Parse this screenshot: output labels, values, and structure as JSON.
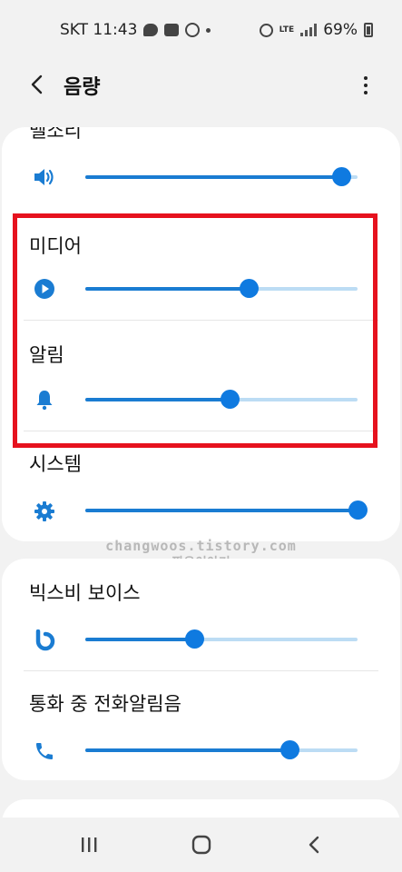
{
  "status_bar": {
    "carrier_time": "SKT 11:43",
    "network": "LTE",
    "battery": "69%"
  },
  "header": {
    "title": "음량"
  },
  "sliders": [
    {
      "id": "ringtone",
      "label": "벨소리",
      "icon": "speaker-icon",
      "level": 0.94
    },
    {
      "id": "media",
      "label": "미디어",
      "icon": "play-circle-icon",
      "level": 0.6
    },
    {
      "id": "notification",
      "label": "알림",
      "icon": "bell-icon",
      "level": 0.53
    },
    {
      "id": "system",
      "label": "시스템",
      "icon": "gear-icon",
      "level": 1.0
    },
    {
      "id": "bixby",
      "label": "빅스비 보이스",
      "icon": "bixby-icon",
      "level": 0.4
    },
    {
      "id": "call",
      "label": "통화 중 전화알림음",
      "icon": "phone-icon",
      "level": 0.75
    }
  ],
  "watermark": {
    "line1": "changwoos.tistory.com",
    "line2": "짱우이야기"
  },
  "colors": {
    "accent": "#1a7cd2",
    "thumb": "#0f7ae0",
    "track_inactive": "#bcdcf4",
    "highlight": "#e6121e"
  }
}
